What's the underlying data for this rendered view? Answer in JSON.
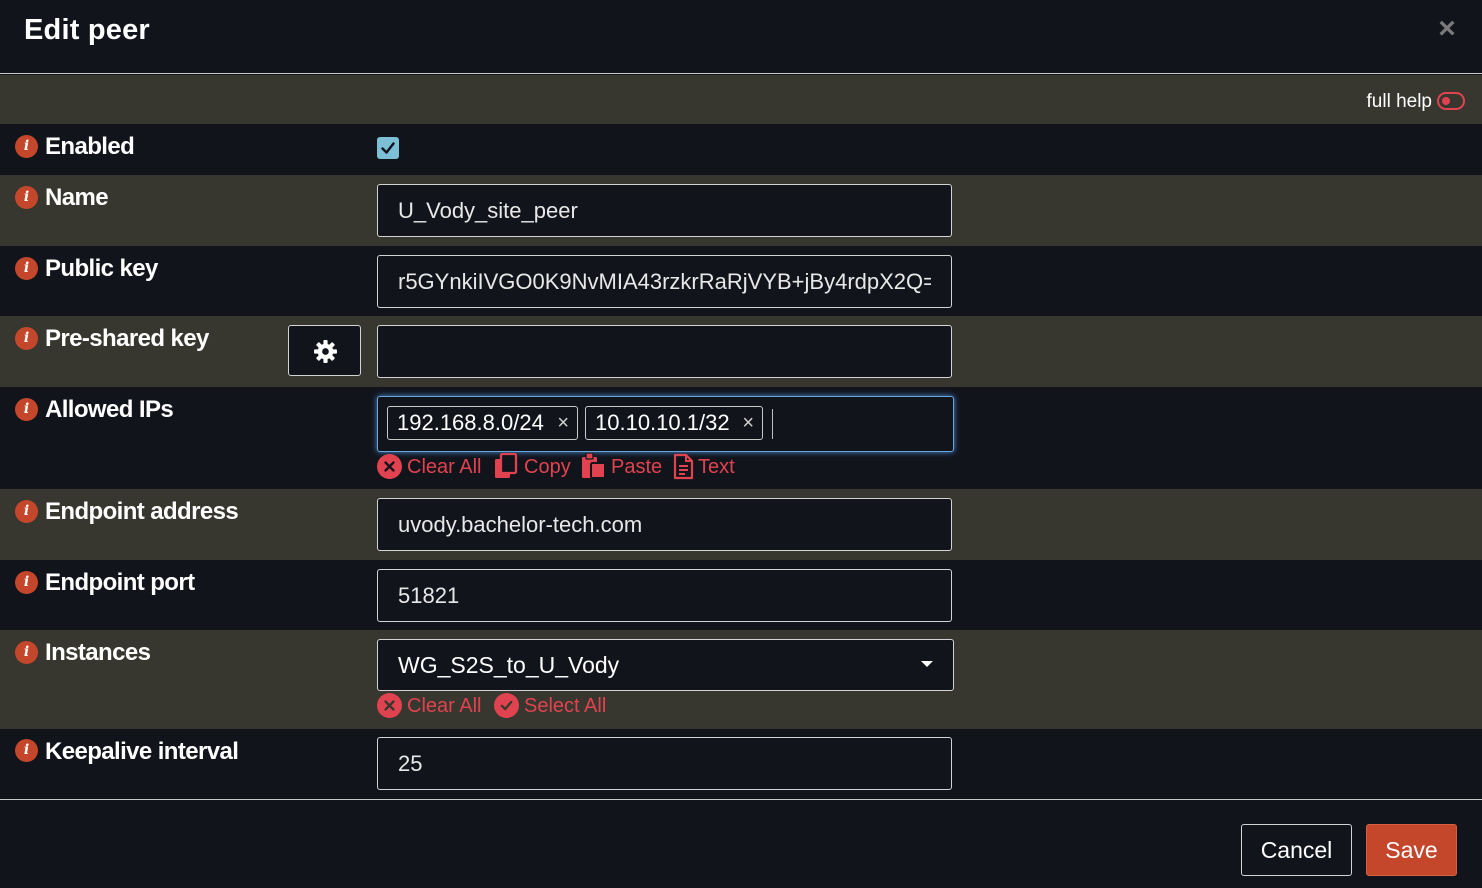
{
  "dialog": {
    "title": "Edit peer",
    "close_label": "×"
  },
  "help": {
    "label": "full help",
    "enabled": false
  },
  "fields": {
    "enabled": {
      "label": "Enabled",
      "checked": true
    },
    "name": {
      "label": "Name",
      "value": "U_Vody_site_peer"
    },
    "public_key": {
      "label": "Public key",
      "value": "r5GYnkiIVGO0K9NvMIA43rzkrRaRjVYB+jBy4rdpX2Q="
    },
    "pre_shared_key": {
      "label": "Pre-shared key",
      "value": ""
    },
    "allowed_ips": {
      "label": "Allowed IPs",
      "tags": [
        "192.168.8.0/24",
        "10.10.10.1/32"
      ],
      "tag_remove": "×",
      "actions": {
        "clear_all": "Clear All",
        "copy": "Copy",
        "paste": "Paste",
        "text": "Text"
      }
    },
    "endpoint_address": {
      "label": "Endpoint address",
      "value": "uvody.bachelor-tech.com"
    },
    "endpoint_port": {
      "label": "Endpoint port",
      "value": "51821"
    },
    "instances": {
      "label": "Instances",
      "selected": "WG_S2S_to_U_Vody",
      "actions": {
        "clear_all": "Clear All",
        "select_all": "Select All"
      }
    },
    "keepalive_interval": {
      "label": "Keepalive interval",
      "value": "25"
    }
  },
  "footer": {
    "cancel_label": "Cancel",
    "save_label": "Save"
  },
  "colors": {
    "background": "#12141c",
    "row_alt": "#37372f",
    "accent_red": "#e0434f",
    "info_icon": "#c4472c",
    "save_button": "#c4472c",
    "checkbox": "#7dbfd6",
    "focus_border": "#6aa5dc"
  },
  "icons": {
    "info": "info-circle-icon",
    "gear": "gear-icon",
    "close": "close-icon",
    "clear": "times-circle-icon",
    "copy": "copy-icon",
    "paste": "paste-icon",
    "text": "file-text-icon",
    "select_all": "check-circle-icon",
    "dropdown": "caret-down-icon",
    "toggle": "toggle-off-icon"
  }
}
